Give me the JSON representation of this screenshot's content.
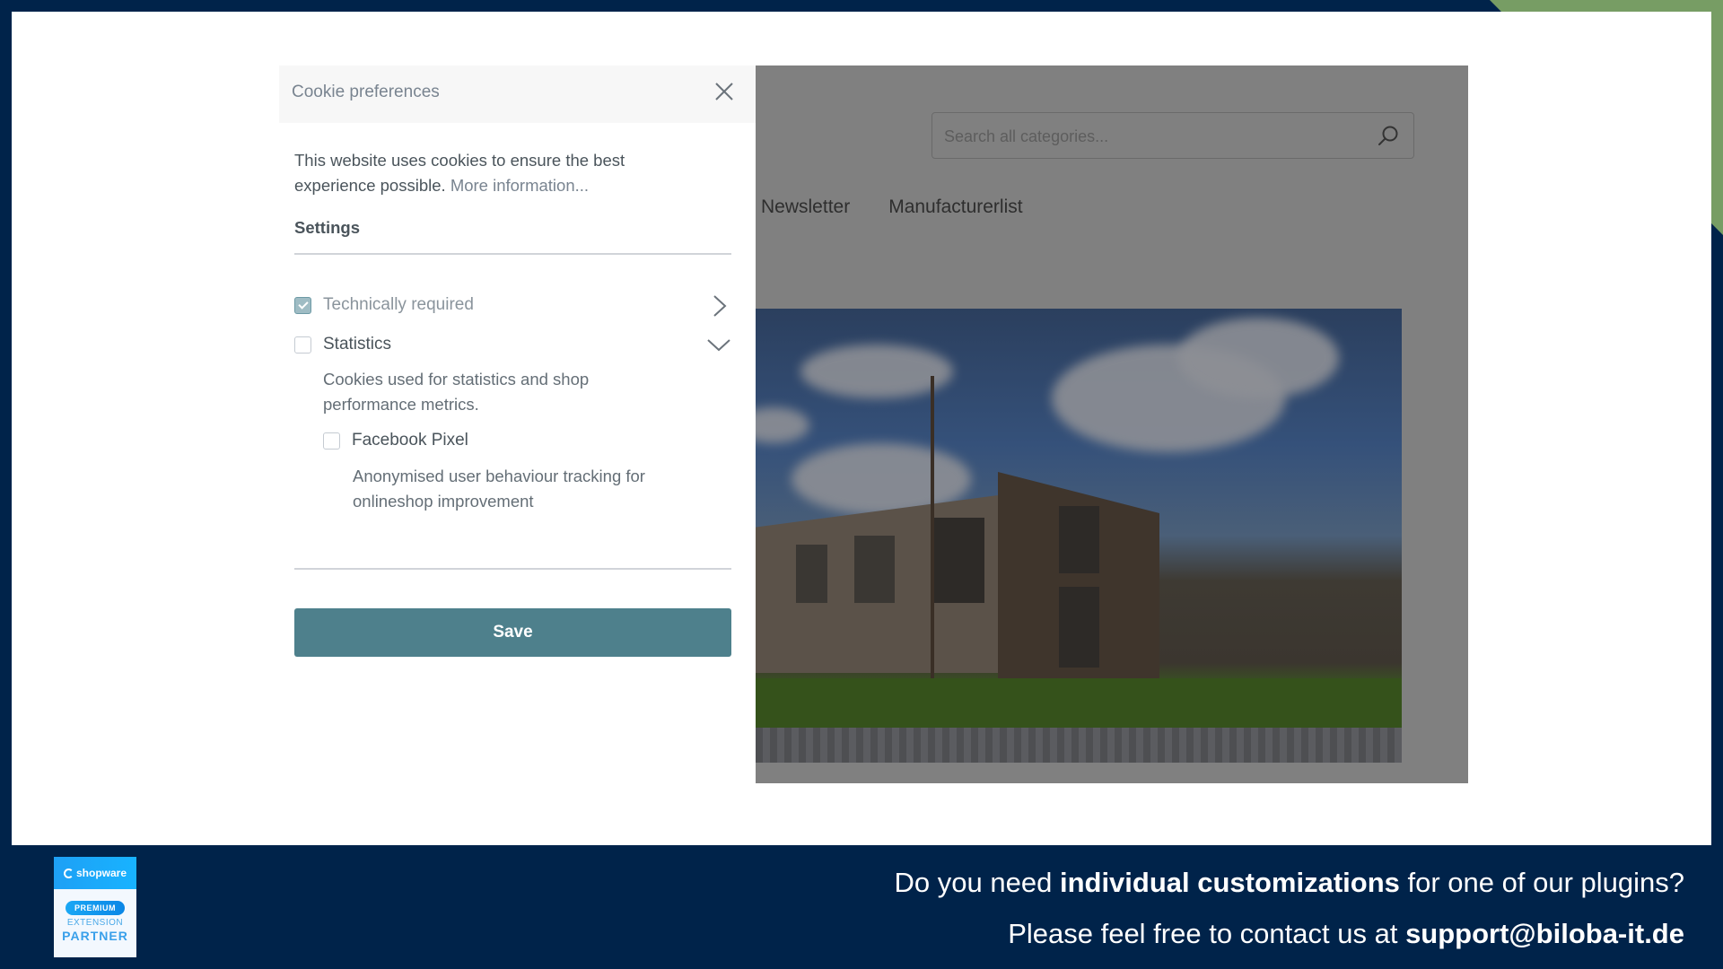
{
  "shop": {
    "search": {
      "placeholder": "Search all categories..."
    },
    "nav": [
      "Newsletter",
      "Manufacturerlist"
    ]
  },
  "modal": {
    "title": "Cookie preferences",
    "intro_text": "This website uses cookies to ensure the best experience possible.",
    "more_info_link": "More information...",
    "settings_heading": "Settings",
    "groups": [
      {
        "label": "Technically required",
        "checked": true,
        "expanded": false
      },
      {
        "label": "Statistics",
        "checked": false,
        "expanded": true,
        "description": "Cookies used for statistics and shop performance metrics.",
        "cookies": [
          {
            "label": "Facebook Pixel",
            "checked": false,
            "description": "Anonymised user behaviour tracking for onlineshop improvement"
          }
        ]
      }
    ],
    "save_label": "Save"
  },
  "badge": {
    "brand": "shopware",
    "tier": "PREMIUM",
    "line1": "EXTENSION",
    "line2": "PARTNER"
  },
  "footer": {
    "line1_pre": "Do you need ",
    "line1_bold": "individual customizations",
    "line1_post": " for one of our plugins?",
    "line2_pre": "Please feel free to contact us at ",
    "line2_bold": "support@biloba-it.de"
  },
  "colors": {
    "frame": "#00234a",
    "accent_green": "#779d64",
    "primary_button": "#4e808c"
  }
}
